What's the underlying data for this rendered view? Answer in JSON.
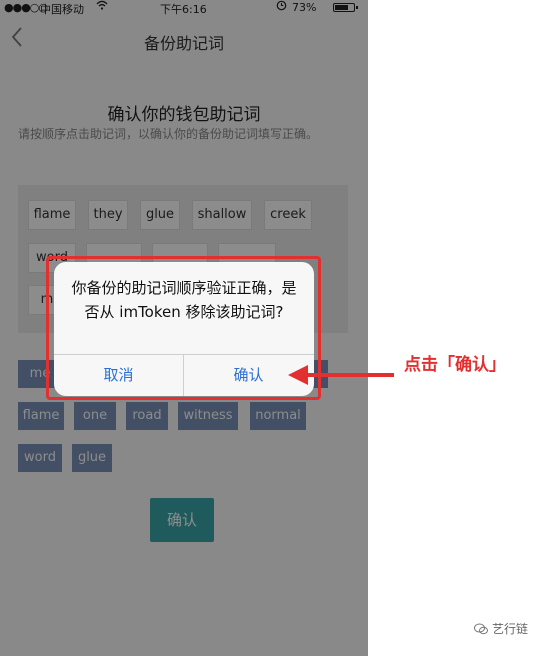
{
  "status_bar": {
    "signal": "●●●○○",
    "carrier": "中国移动",
    "time": "下午6:16",
    "battery": "73%",
    "battery_level": 0.73
  },
  "nav": {
    "back_icon": "chevron-left-icon",
    "title": "备份助记词"
  },
  "page": {
    "heading": "确认你的钱包助记词",
    "instruction": "请按顺序点击助记词，以确认你的备份助记词填写正确。"
  },
  "selected_words": [
    [
      "flame",
      "they",
      "glue",
      "shallow",
      "creek"
    ],
    [
      "word",
      "",
      "",
      ""
    ],
    [
      "m",
      ""
    ]
  ],
  "word_options": [
    [
      "me",
      "",
      "",
      "",
      ""
    ],
    [
      "flame",
      "one",
      "road",
      "witness",
      "normal"
    ],
    [
      "word",
      "glue"
    ]
  ],
  "confirm_button": "确认",
  "dialog": {
    "message": "你备份的助记词顺序验证正确，是否从 imToken 移除该助记词?",
    "cancel": "取消",
    "confirm": "确认"
  },
  "annotation": {
    "text": "点击「确认」",
    "color": "#e23030"
  },
  "watermark": "艺行链"
}
